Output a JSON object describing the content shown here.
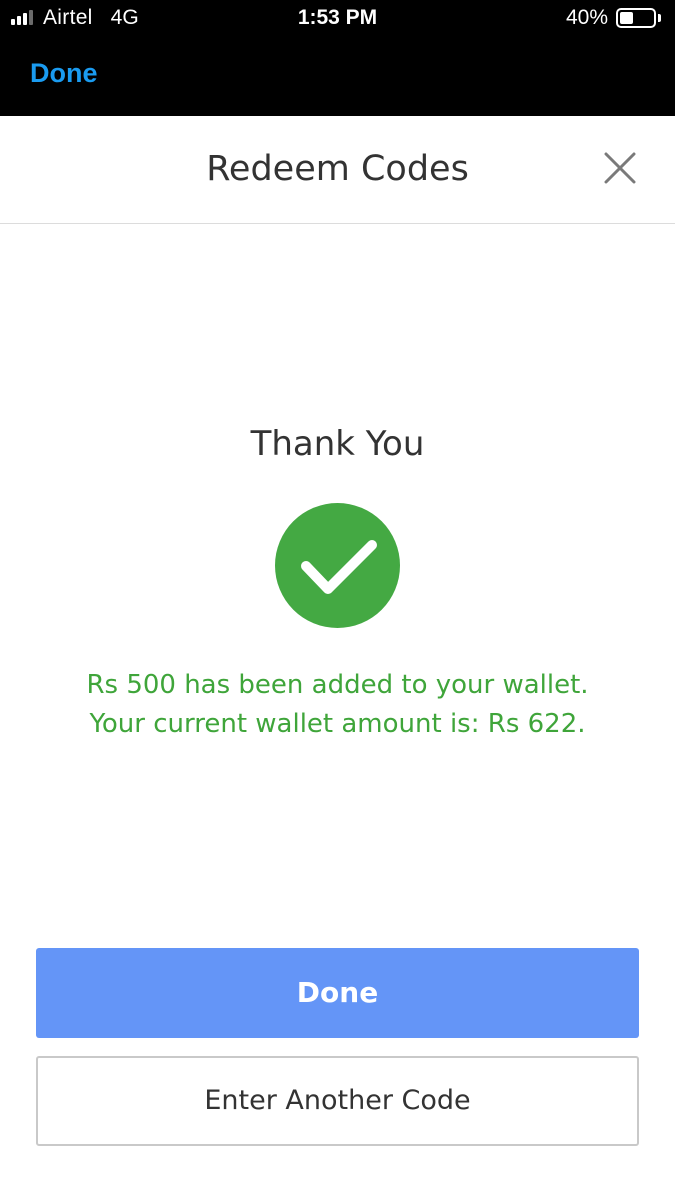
{
  "status_bar": {
    "carrier": "Airtel",
    "network": "4G",
    "time": "1:53 PM",
    "battery_percent_label": "40%",
    "battery_level": 0.4,
    "signal_bars_active": 3,
    "signal_bars_total": 4
  },
  "browser": {
    "done_label": "Done",
    "done_color": "#1a9bf0"
  },
  "header": {
    "title": "Redeem Codes",
    "close_icon": "close-icon"
  },
  "result": {
    "heading": "Thank You",
    "icon": "checkmark-icon",
    "icon_color": "#44a943",
    "message_line1": "Rs 500 has been added to your wallet.",
    "message_line2": "Your current wallet amount is: Rs 622.",
    "message_color": "#3fa53a"
  },
  "actions": {
    "done_label": "Done",
    "done_color": "#6495f7",
    "another_label": "Enter Another Code"
  }
}
